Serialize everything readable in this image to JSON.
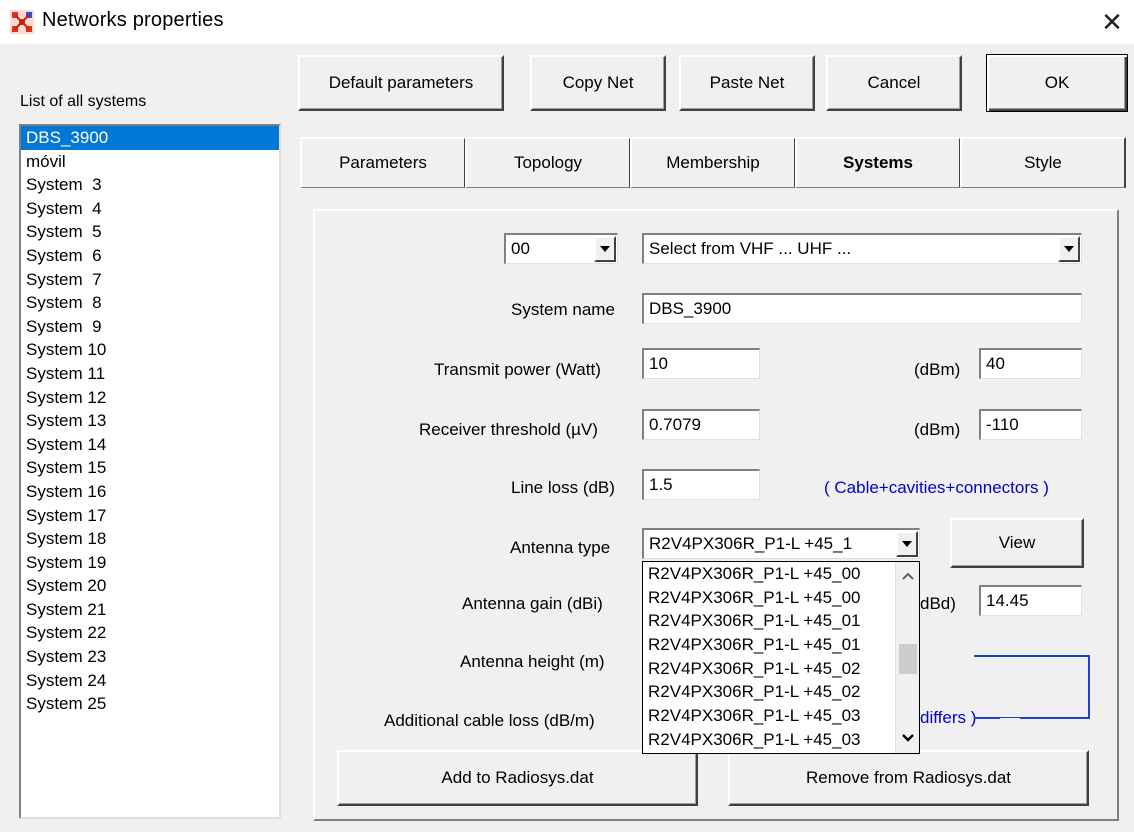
{
  "window": {
    "title": "Networks properties",
    "close_glyph": "✕"
  },
  "toolbar": {
    "default_parameters": "Default parameters",
    "copy_net": "Copy Net",
    "paste_net": "Paste Net",
    "cancel": "Cancel",
    "ok": "OK"
  },
  "systems_list": {
    "label": "List of all systems",
    "items": [
      "DBS_3900",
      "móvil",
      "System  3",
      "System  4",
      "System  5",
      "System  6",
      "System  7",
      "System  8",
      "System  9",
      "System 10",
      "System 11",
      "System 12",
      "System 13",
      "System 14",
      "System 15",
      "System 16",
      "System 17",
      "System 18",
      "System 19",
      "System 20",
      "System 21",
      "System 22",
      "System 23",
      "System 24",
      "System 25"
    ],
    "selected_index": 0
  },
  "tabs": [
    "Parameters",
    "Topology",
    "Membership",
    "Systems",
    "Style"
  ],
  "active_tab": "Systems",
  "form": {
    "system_number": "00",
    "band_select": "Select from VHF ... UHF ...",
    "system_name_label": "System name",
    "system_name": "DBS_3900",
    "transmit_power_label": "Transmit power (Watt)",
    "transmit_power": "10",
    "transmit_dbm_label": "(dBm)",
    "transmit_dbm": "40",
    "receiver_threshold_label": "Receiver threshold (µV)",
    "receiver_threshold": "0.7079",
    "receiver_dbm_label": "(dBm)",
    "receiver_dbm": "-110",
    "line_loss_label": "Line loss (dB)",
    "line_loss": "1.5",
    "line_loss_note": "( Cable+cavities+connectors )",
    "antenna_type_label": "Antenna type",
    "antenna_type": "R2V4PX306R_P1-L +45_1",
    "view_button": "View",
    "antenna_gain_label": "Antenna gain (dBi)",
    "antenna_gain_dbd_label": "dBd)",
    "antenna_gain_dbd": "14.45",
    "antenna_height_label": "Antenna height (m)",
    "additional_cable_loss_label": "Additional cable loss (dB/m)",
    "differs_note": "differs )",
    "add_button": "Add to Radiosys.dat",
    "remove_button": "Remove from Radiosys.dat"
  },
  "antenna_dropdown": {
    "options": [
      "R2V4PX306R_P1-L +45_00",
      "R2V4PX306R_P1-L +45_00",
      "R2V4PX306R_P1-L +45_01",
      "R2V4PX306R_P1-L +45_01",
      "R2V4PX306R_P1-L +45_02",
      "R2V4PX306R_P1-L +45_02",
      "R2V4PX306R_P1-L +45_03",
      "R2V4PX306R_P1-L +45_03"
    ]
  },
  "colors": {
    "selection": "#0078d7",
    "link_blue": "#0000cc",
    "face": "#f0f0f0"
  }
}
